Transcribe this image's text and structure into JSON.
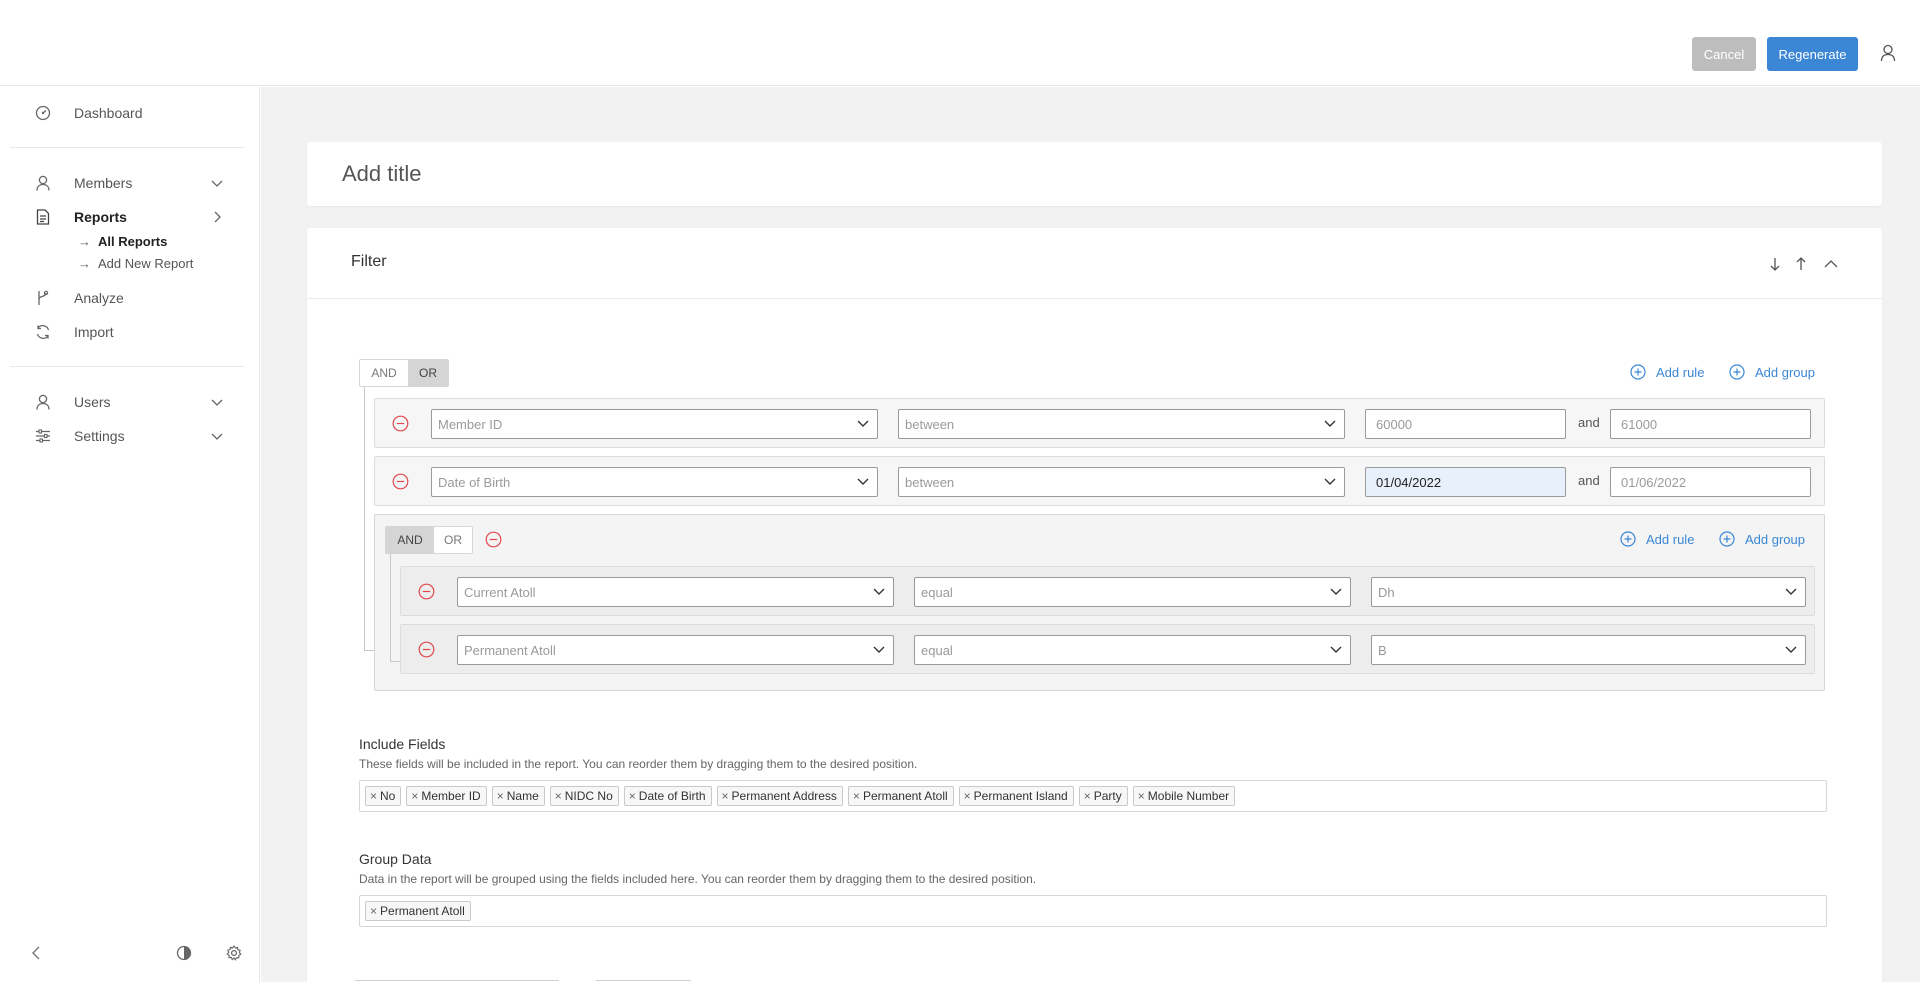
{
  "header": {
    "cancel_label": "Cancel",
    "regenerate_label": "Regenerate",
    "user_icon": "user-icon"
  },
  "sidebar": {
    "items": [
      {
        "label": "Dashboard",
        "icon": "dashboard-icon"
      },
      {
        "label": "Members",
        "icon": "user-icon",
        "expandable": true
      },
      {
        "label": "Reports",
        "icon": "document-icon",
        "expanded": true
      },
      {
        "label": "Analyze",
        "icon": "branch-icon"
      },
      {
        "label": "Import",
        "icon": "refresh-icon"
      },
      {
        "label": "Users",
        "icon": "user-icon",
        "expandable": true
      },
      {
        "label": "Settings",
        "icon": "sliders-icon",
        "expandable": true
      }
    ],
    "reports_sub": [
      {
        "label": "All Reports",
        "active": true
      },
      {
        "label": "Add New Report",
        "active": false
      }
    ],
    "bottom_icons": [
      "collapse-left-icon",
      "contrast-icon",
      "gear-icon"
    ]
  },
  "main": {
    "title_placeholder": "Add title",
    "filter": {
      "title": "Filter",
      "controls": [
        "arrow-down-icon",
        "arrow-up-icon",
        "chevron-up-icon"
      ],
      "root": {
        "and_label": "AND",
        "or_label": "OR",
        "selected": "OR",
        "add_rule_label": "Add rule",
        "add_group_label": "Add group",
        "rules": [
          {
            "field": "Member ID",
            "operator": "between",
            "value1": "60000",
            "value2": "61000",
            "value1_is_placeholder": true,
            "connector": "and"
          },
          {
            "field": "Date of Birth",
            "operator": "between",
            "value1": "01/04/2022",
            "value2": "01/06/2022",
            "value1_is_placeholder": false,
            "connector": "and"
          }
        ],
        "group": {
          "and_label": "AND",
          "or_label": "OR",
          "selected": "AND",
          "add_rule_label": "Add rule",
          "add_group_label": "Add group",
          "rules": [
            {
              "field": "Current Atoll",
              "operator": "equal",
              "value": "Dh"
            },
            {
              "field": "Permanent Atoll",
              "operator": "equal",
              "value": "B"
            }
          ]
        }
      }
    },
    "include_fields": {
      "title": "Include Fields",
      "description": "These fields will be included in the report. You can reorder them by dragging them to the desired position.",
      "tags": [
        "No",
        "Member ID",
        "Name",
        "NIDC No",
        "Date of Birth",
        "Permanent Address",
        "Permanent Atoll",
        "Permanent Island",
        "Party",
        "Mobile Number"
      ]
    },
    "group_data": {
      "title": "Group Data",
      "description": "Data in the report will be grouped using the fields included here. You can reorder them by dragging them to the desired position.",
      "tags": [
        "Permanent Atoll"
      ]
    }
  }
}
